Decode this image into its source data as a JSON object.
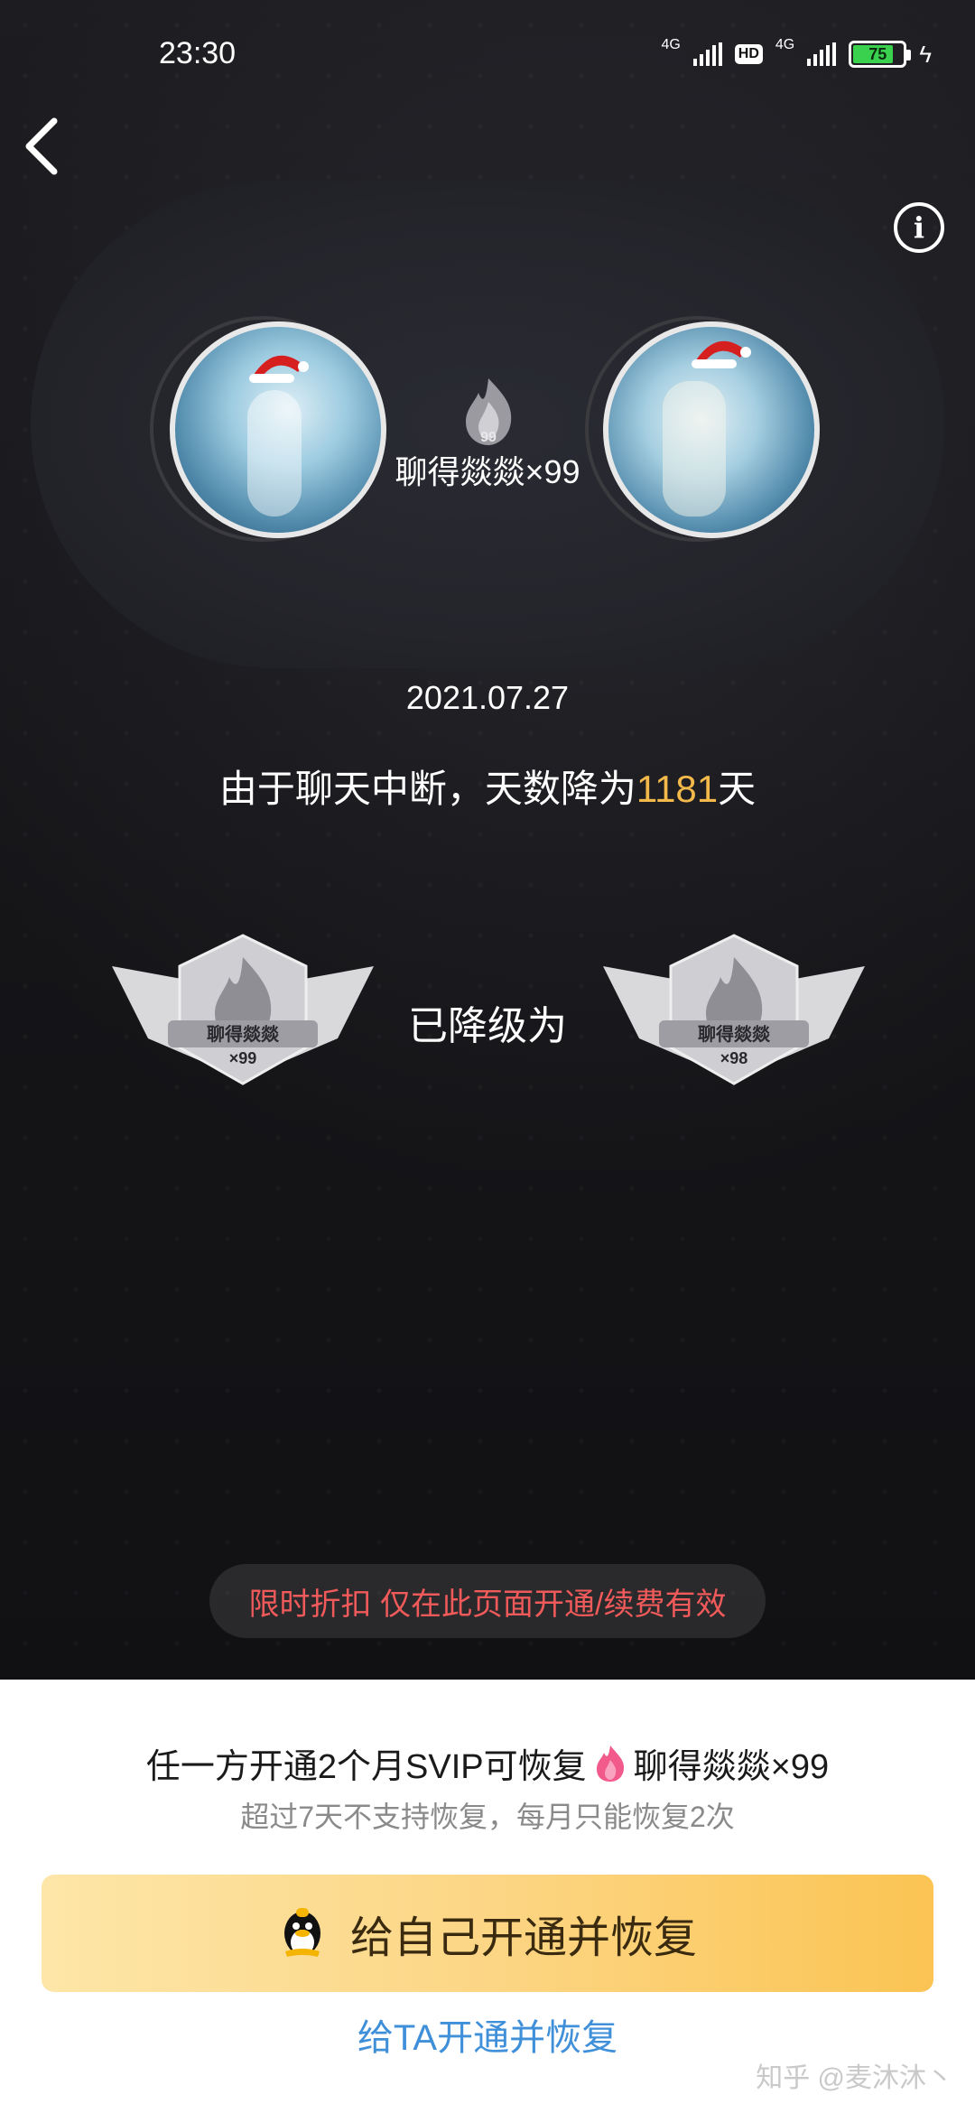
{
  "status_bar": {
    "time": "23:30",
    "network_1": "4G",
    "network_2": "4G",
    "hd": "HD",
    "battery": "75"
  },
  "header": {
    "back_icon": "chevron-left-icon",
    "info_icon": "info-icon"
  },
  "relationship": {
    "level_name": "聊得燚燚×99",
    "date": "2021.07.27",
    "desc_prefix": "由于聊天中断，天数降为",
    "days": "1181",
    "desc_suffix": "天",
    "downgrade_text": "已降级为",
    "medal_old_label": "聊得燚燚",
    "medal_old_level": "×99",
    "medal_new_label": "聊得燚燚",
    "medal_new_level": "×98"
  },
  "promo": {
    "text": "限时折扣 仅在此页面开通/续费有效"
  },
  "sheet": {
    "restore_prefix": "任一方开通2个月SVIP可恢复",
    "restore_level": "聊得燚燚×99",
    "limit_text": "超过7天不支持恢复，每月只能恢复2次",
    "btn_self": "给自己开通并恢复",
    "btn_ta": "给TA开通并恢复"
  },
  "watermark": "知乎 @麦沐沐丶",
  "colors": {
    "highlight": "#f3b94a",
    "promo_text": "#f05a5a",
    "link": "#3f8fd9",
    "button_gradient_start": "#fde6a8",
    "button_gradient_end": "#fbc453"
  }
}
